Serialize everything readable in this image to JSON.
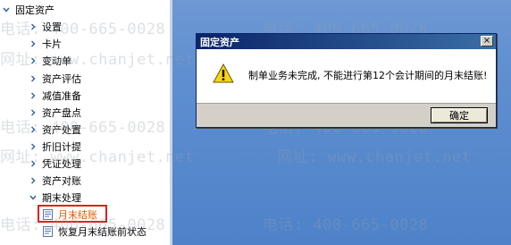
{
  "sidebar": {
    "root": "固定资产",
    "items": [
      {
        "label": "设置"
      },
      {
        "label": "卡片"
      },
      {
        "label": "变动单"
      },
      {
        "label": "资产评估"
      },
      {
        "label": "减值准备"
      },
      {
        "label": "资产盘点"
      },
      {
        "label": "资产处置"
      },
      {
        "label": "折旧计提"
      },
      {
        "label": "凭证处理"
      },
      {
        "label": "资产对账"
      },
      {
        "label": "期末处理"
      }
    ],
    "sub_items": [
      {
        "label": "月末结账"
      },
      {
        "label": "恢复月末结账前状态"
      }
    ]
  },
  "watermark": {
    "phone": "电话: 400-665-0028",
    "site": "网址: www.chanjet.net"
  },
  "dialog": {
    "title": "固定资产",
    "close": "×",
    "message": "制单业务未完成, 不能进行第12个会计期间的月末结账!",
    "ok_label": "确定",
    "warn_icon": "warning-icon"
  },
  "colors": {
    "main_bg": "#5f8fd0",
    "title_bar": "#0a246a",
    "highlight": "#e02020",
    "active_text": "#e05a00"
  }
}
